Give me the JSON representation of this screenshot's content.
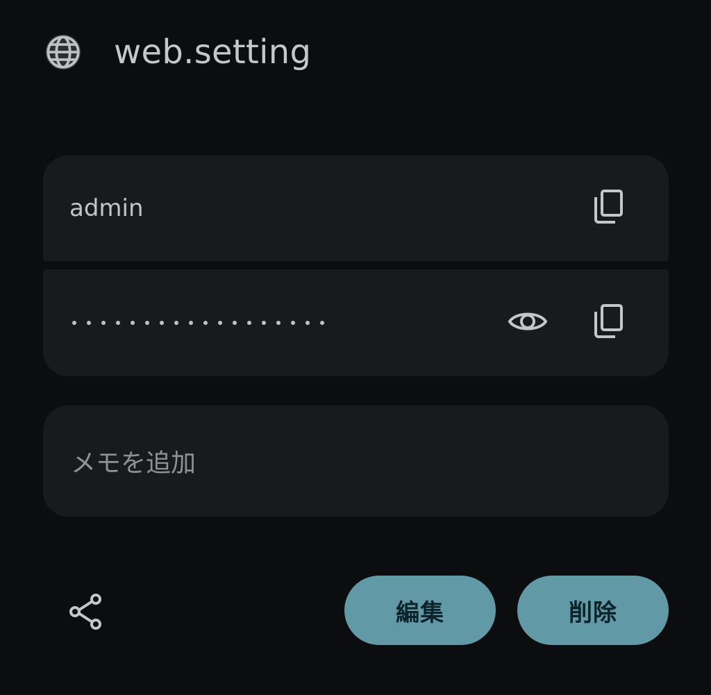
{
  "header": {
    "icon": "globe-icon",
    "title": "web.setting"
  },
  "credentials": {
    "username": "admin",
    "password_masked_dots": 18,
    "username_copy_icon": "copy-icon",
    "password_reveal_icon": "eye-icon",
    "password_copy_icon": "copy-icon"
  },
  "memo": {
    "placeholder": "メモを追加"
  },
  "actions": {
    "share_icon": "share-icon",
    "edit_label": "編集",
    "delete_label": "削除"
  },
  "colors": {
    "background": "#0c0d0f",
    "card": "#171b1c",
    "accent": "#6299a6",
    "accent_text": "#0b2429"
  }
}
